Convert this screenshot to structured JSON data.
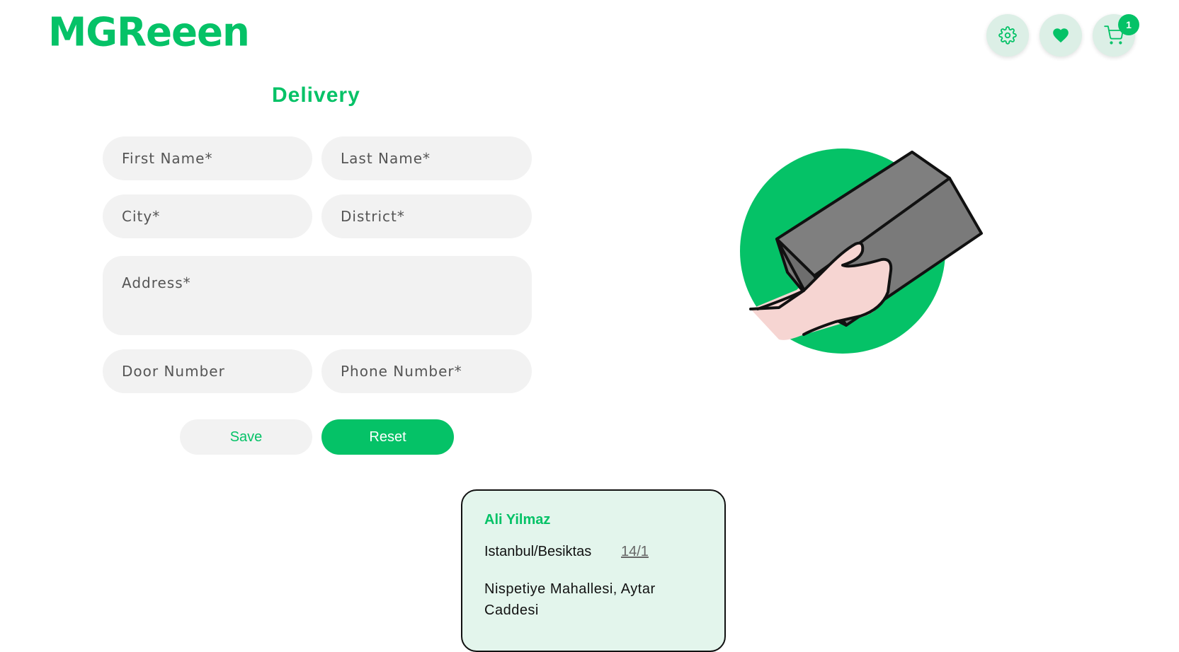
{
  "header": {
    "logo": "MGReeen",
    "settings_icon": "gear-icon",
    "favorites_icon": "heart-icon",
    "cart_icon": "cart-icon",
    "cart_count": "1"
  },
  "form": {
    "title": "Delivery",
    "first_name_placeholder": "First Name*",
    "last_name_placeholder": "Last Name*",
    "city_placeholder": "City*",
    "district_placeholder": "District*",
    "address_placeholder": "Address*",
    "door_number_placeholder": "Door Number",
    "phone_number_placeholder": "Phone Number*",
    "save_label": "Save",
    "reset_label": "Reset"
  },
  "illustration": {
    "icon": "hand-holding-box-icon"
  },
  "saved_address": {
    "name": "Ali Yilmaz",
    "city_district": "Istanbul/Besiktas",
    "door_number": "14/1",
    "address": "Nispetiye Mahallesi, Aytar Caddesi"
  },
  "colors": {
    "accent": "#05c267",
    "field_background": "#f2f2f2",
    "card_background": "#e3f5ec",
    "icon_button_background": "#dcefe6"
  }
}
